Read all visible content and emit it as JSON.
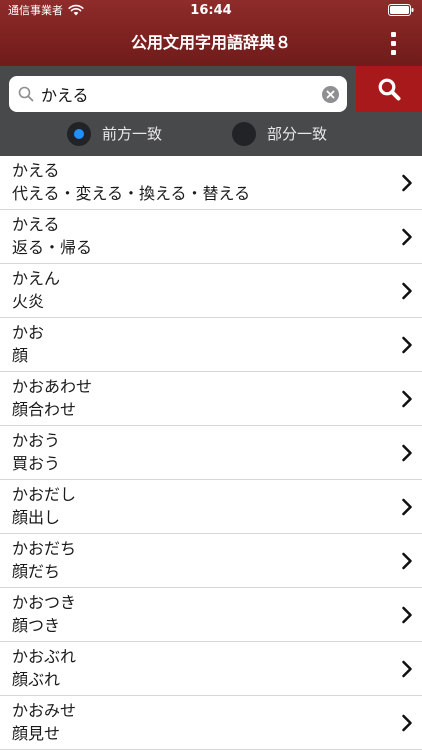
{
  "status_bar": {
    "carrier": "通信事業者",
    "time": "16:44"
  },
  "nav": {
    "title": "公用文用字用語辞典８"
  },
  "search": {
    "query": "かえる",
    "mode_prefix_label": "前方一致",
    "mode_partial_label": "部分一致",
    "selected_mode": "前方一致"
  },
  "results": [
    {
      "reading": "かえる",
      "kanji": "代える・変える・換える・替える"
    },
    {
      "reading": "かえる",
      "kanji": "返る・帰る"
    },
    {
      "reading": "かえん",
      "kanji": "火炎"
    },
    {
      "reading": "かお",
      "kanji": "顔"
    },
    {
      "reading": "かおあわせ",
      "kanji": "顔合わせ"
    },
    {
      "reading": "かおう",
      "kanji": "買おう"
    },
    {
      "reading": "かおだし",
      "kanji": "顔出し"
    },
    {
      "reading": "かおだち",
      "kanji": "顔だち"
    },
    {
      "reading": "かおつき",
      "kanji": "顔つき"
    },
    {
      "reading": "かおぶれ",
      "kanji": "顔ぶれ"
    },
    {
      "reading": "かおみせ",
      "kanji": "顔見せ"
    }
  ],
  "colors": {
    "header": "#7e2220",
    "search_button": "#a8191b",
    "search_panel": "#48494b",
    "radio_selected": "#1e90ff"
  },
  "icons": {
    "wifi": "wifi-icon",
    "battery": "battery-icon",
    "more": "more-vertical-icon",
    "search_field": "magnifier-icon",
    "clear": "clear-circle-icon",
    "search_button": "magnifier-icon",
    "row_disclosure": "chevron-right-icon"
  }
}
